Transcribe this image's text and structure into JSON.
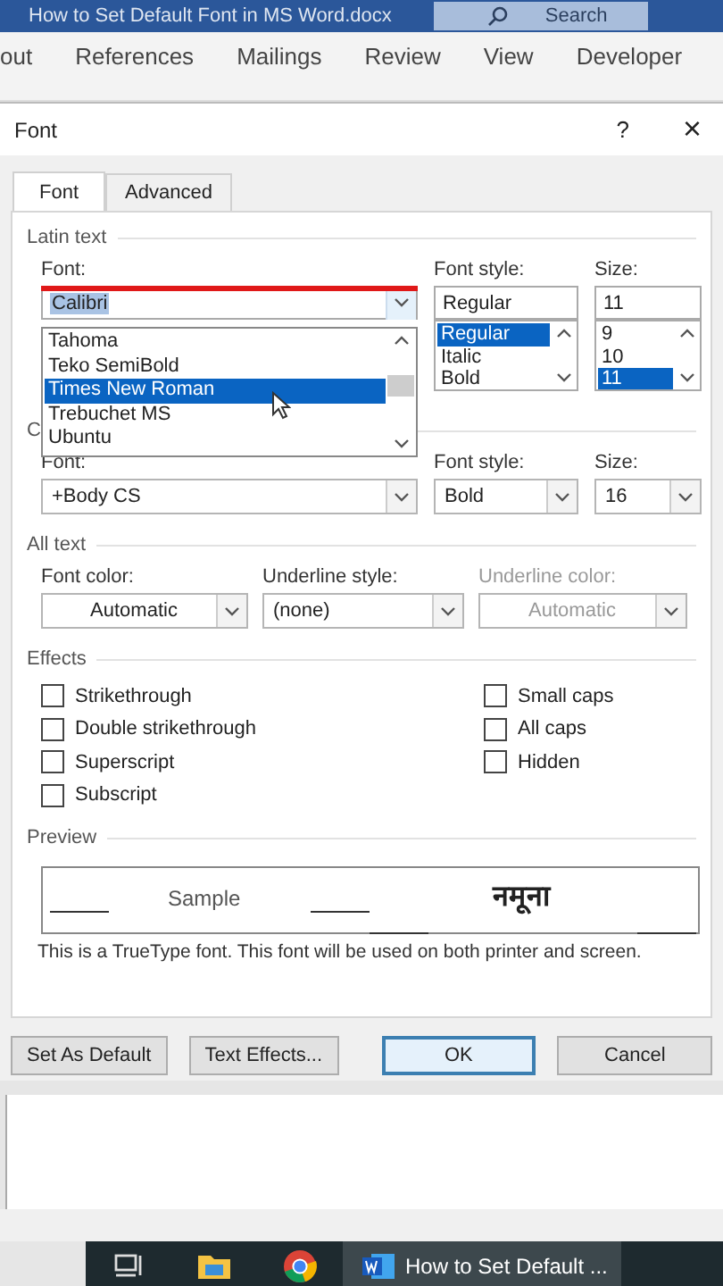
{
  "word_window": {
    "title": "How to Set Default Font in MS Word.docx",
    "search": {
      "placeholder": "Search"
    }
  },
  "ribbon_tabs": [
    {
      "label": "out",
      "selected": false
    },
    {
      "label": "References",
      "selected": false
    },
    {
      "label": "Mailings",
      "selected": false
    },
    {
      "label": "Review",
      "selected": false
    },
    {
      "label": "View",
      "selected": false
    },
    {
      "label": "Developer",
      "selected": false
    }
  ],
  "dialog": {
    "title": "Font",
    "help": "?",
    "close": "×",
    "tabs": [
      {
        "label": "Font",
        "selected": true
      },
      {
        "label": "Advanced",
        "selected": false
      }
    ],
    "latin": {
      "heading": "Latin text",
      "font_label": "Font:",
      "font_value": "Calibri",
      "style_label": "Font style:",
      "style_value": "Regular",
      "size_label": "Size:",
      "size_value": "11",
      "font_list": [
        {
          "label": "Tahoma",
          "selected": false
        },
        {
          "label": "Teko SemiBold",
          "selected": false
        },
        {
          "label": "Times New Roman",
          "selected": true
        },
        {
          "label": "Trebuchet MS",
          "selected": false
        },
        {
          "label": "Ubuntu",
          "selected": false
        }
      ],
      "style_list": [
        {
          "label": "Regular",
          "selected": true
        },
        {
          "label": "Italic",
          "selected": false
        },
        {
          "label": "Bold",
          "selected": false
        }
      ],
      "size_list": [
        {
          "label": "9",
          "selected": false
        },
        {
          "label": "10",
          "selected": false
        },
        {
          "label": "11",
          "selected": true
        }
      ]
    },
    "complex": {
      "heading": "C",
      "font_label": "Font:",
      "font_value": "+Body CS",
      "style_label": "Font style:",
      "style_value": "Bold",
      "size_label": "Size:",
      "size_value": "16"
    },
    "all_text": {
      "heading": "All text",
      "combos": [
        {
          "label": "Font color:",
          "value": "Automatic",
          "centered": true,
          "disabled": false
        },
        {
          "label": "Underline style:",
          "value": "(none)",
          "centered": false,
          "disabled": false
        },
        {
          "label": "Underline color:",
          "value": "Automatic",
          "centered": true,
          "disabled": true
        }
      ]
    },
    "effects": {
      "heading": "Effects",
      "left": [
        {
          "label": "Strikethrough",
          "checked": false
        },
        {
          "label": "Double strikethrough",
          "checked": false
        },
        {
          "label": "Superscript",
          "checked": false
        },
        {
          "label": "Subscript",
          "checked": false
        }
      ],
      "right": [
        {
          "label": "Small caps",
          "checked": false
        },
        {
          "label": "All caps",
          "checked": false
        },
        {
          "label": "Hidden",
          "checked": false
        }
      ]
    },
    "preview": {
      "heading": "Preview",
      "sample": "Sample",
      "sample_cs": "नमूना",
      "note": "This is a TrueType font. This font will be used on both printer and screen."
    },
    "buttons": [
      {
        "label": "Set As Default",
        "default": false
      },
      {
        "label": "Text Effects...",
        "default": false
      },
      {
        "label": "OK",
        "default": true
      },
      {
        "label": "Cancel",
        "default": false
      }
    ]
  },
  "taskbar": {
    "items": [
      {
        "kind": "taskview",
        "active": false
      },
      {
        "kind": "folder",
        "active": false
      },
      {
        "kind": "chrome",
        "active": false
      },
      {
        "kind": "word",
        "label": "How to Set Default ...",
        "active": true
      }
    ]
  }
}
